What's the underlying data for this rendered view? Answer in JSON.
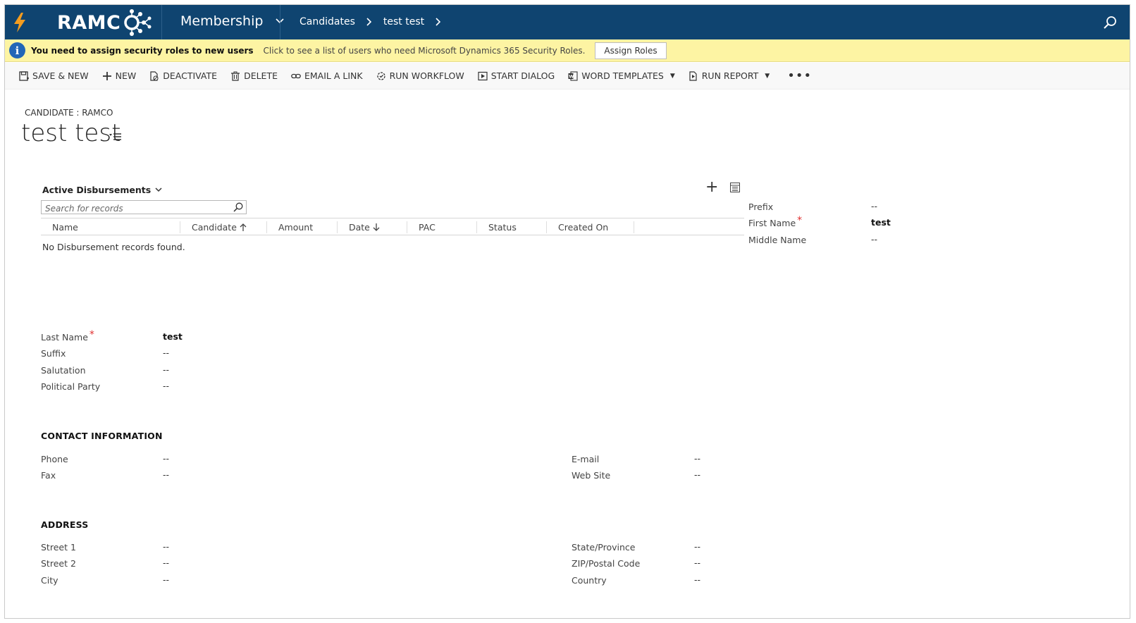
{
  "nav": {
    "logo": "RAMC",
    "app": "Membership",
    "crumb_entity": "Candidates",
    "crumb_record": "test test"
  },
  "notice": {
    "strong": "You need to assign security roles to new users",
    "message": "Click to see a list of users who need Microsoft Dynamics 365 Security Roles.",
    "button": "Assign Roles"
  },
  "commands": {
    "save_new": "SAVE & NEW",
    "new": "NEW",
    "deactivate": "DEACTIVATE",
    "delete": "DELETE",
    "email_link": "EMAIL A LINK",
    "run_workflow": "RUN WORKFLOW",
    "start_dialog": "START DIALOG",
    "word_templates": "WORD TEMPLATES",
    "run_report": "RUN REPORT",
    "more": "•••"
  },
  "header": {
    "entity_type": "CANDIDATE : RAMCO",
    "title": "test test"
  },
  "subgrid": {
    "title": "Active Disbursements",
    "search_placeholder": "Search for records",
    "columns": {
      "name": "Name",
      "candidate": "Candidate",
      "amount": "Amount",
      "date": "Date",
      "pac": "PAC",
      "status": "Status",
      "created_on": "Created On"
    },
    "empty_message": "No Disbursement records found."
  },
  "fields": {
    "prefix": {
      "label": "Prefix",
      "value": "--"
    },
    "first_name": {
      "label": "First Name",
      "value": "test"
    },
    "middle_name": {
      "label": "Middle Name",
      "value": "--"
    },
    "last_name": {
      "label": "Last Name",
      "value": "test"
    },
    "suffix": {
      "label": "Suffix",
      "value": "--"
    },
    "salutation": {
      "label": "Salutation",
      "value": "--"
    },
    "political_party": {
      "label": "Political Party",
      "value": "--"
    }
  },
  "contact": {
    "section_title": "CONTACT INFORMATION",
    "phone": {
      "label": "Phone",
      "value": "--"
    },
    "fax": {
      "label": "Fax",
      "value": "--"
    },
    "email": {
      "label": "E-mail",
      "value": "--"
    },
    "website": {
      "label": "Web Site",
      "value": "--"
    }
  },
  "address": {
    "section_title": "ADDRESS",
    "street1": {
      "label": "Street 1",
      "value": "--"
    },
    "street2": {
      "label": "Street 2",
      "value": "--"
    },
    "city": {
      "label": "City",
      "value": "--"
    },
    "state": {
      "label": "State/Province",
      "value": "--"
    },
    "zip": {
      "label": "ZIP/Postal Code",
      "value": "--"
    },
    "country": {
      "label": "Country",
      "value": "--"
    }
  },
  "required_marker": "*",
  "colors": {
    "nav_bg": "#0f4470",
    "notice_bg": "#fdf4a3",
    "info_blue": "#2266b7",
    "bolt_orange": "#f39c1f",
    "required_red": "#e03030"
  }
}
